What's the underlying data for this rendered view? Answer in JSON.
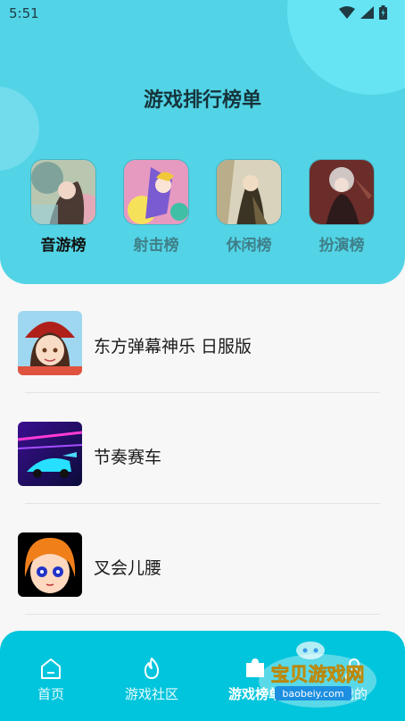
{
  "status": {
    "time": "5:51"
  },
  "title": "游戏排行榜单",
  "categories": [
    {
      "label": "音游榜",
      "active": true
    },
    {
      "label": "射击榜",
      "active": false
    },
    {
      "label": "休闲榜",
      "active": false
    },
    {
      "label": "扮演榜",
      "active": false
    }
  ],
  "games": [
    {
      "name": "东方弹幕神乐 日服版"
    },
    {
      "name": "节奏赛车"
    },
    {
      "name": "叉会儿腰"
    }
  ],
  "nav": {
    "tabs": [
      {
        "label": "首页",
        "icon": "home-icon"
      },
      {
        "label": "游戏社区",
        "icon": "flame-icon"
      },
      {
        "label": "游戏榜单",
        "icon": "puzzle-icon",
        "active": true
      },
      {
        "label": "我的",
        "icon": "person-icon"
      }
    ]
  },
  "watermark": {
    "brand": "宝贝游戏网",
    "url": "baobeiy.com"
  }
}
